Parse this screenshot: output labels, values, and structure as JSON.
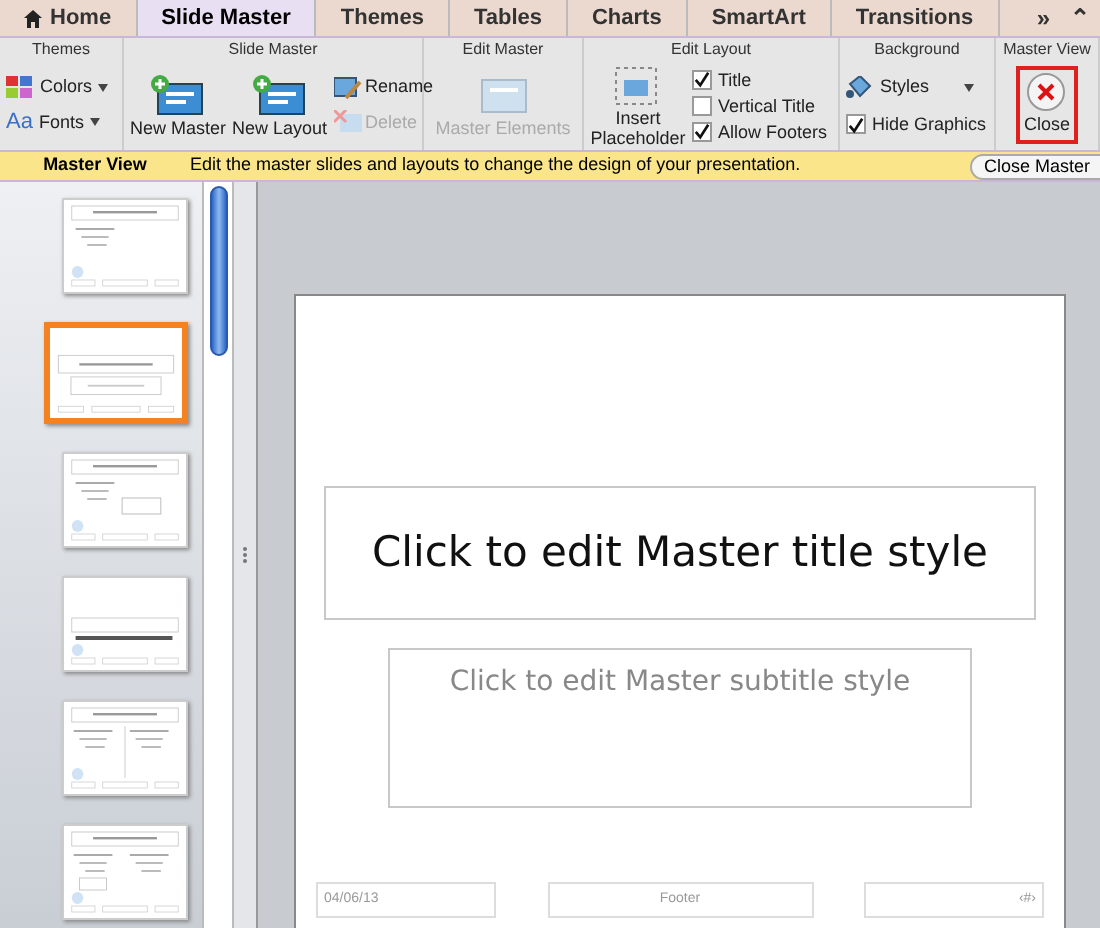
{
  "tabs": [
    {
      "label": "Home",
      "selected": false,
      "kind": "home"
    },
    {
      "label": "Slide Master",
      "selected": true,
      "kind": "plain"
    },
    {
      "label": "Themes",
      "selected": false,
      "kind": "plain"
    },
    {
      "label": "Tables",
      "selected": false,
      "kind": "plain"
    },
    {
      "label": "Charts",
      "selected": false,
      "kind": "plain"
    },
    {
      "label": "SmartArt",
      "selected": false,
      "kind": "plain"
    },
    {
      "label": "Transitions",
      "selected": false,
      "kind": "plain"
    }
  ],
  "tab_controls": [
    "»",
    "⌃"
  ],
  "ribbon": {
    "themes": {
      "title": "Themes",
      "colors": "Colors",
      "fonts_glyph": "Aa",
      "fonts": "Fonts"
    },
    "slide_master": {
      "title": "Slide Master",
      "new_master": "New Master",
      "new_layout": "New Layout",
      "rename": "Rename",
      "delete": "Delete",
      "delete_disabled": true
    },
    "edit_master": {
      "title": "Edit Master",
      "master_elements": "Master Elements",
      "disabled": true
    },
    "edit_layout": {
      "title": "Edit Layout",
      "insert_placeholder": "Insert Placeholder",
      "checkboxes": [
        {
          "label": "Title",
          "checked": true
        },
        {
          "label": "Vertical Title",
          "checked": false
        },
        {
          "label": "Allow Footers",
          "checked": true
        }
      ]
    },
    "background": {
      "title": "Background",
      "styles": "Styles",
      "hide_graphics": {
        "label": "Hide Graphics",
        "checked": true
      }
    },
    "master_view": {
      "title": "Master View",
      "close": "Close"
    }
  },
  "message_bar": {
    "label": "Master View",
    "text": "Edit the master slides and layouts to change the design of your presentation.",
    "button": "Close Master"
  },
  "thumbnails": [
    {
      "kind": "master",
      "selected": false
    },
    {
      "kind": "title",
      "selected": true
    },
    {
      "kind": "content",
      "selected": false
    },
    {
      "kind": "section",
      "selected": false
    },
    {
      "kind": "two_content",
      "selected": false
    },
    {
      "kind": "comparison",
      "selected": false
    }
  ],
  "slide": {
    "title": "Click to edit Master title style",
    "subtitle": "Click to edit Master subtitle style",
    "date": "04/06/13",
    "footer": "Footer",
    "number": "‹#›"
  }
}
